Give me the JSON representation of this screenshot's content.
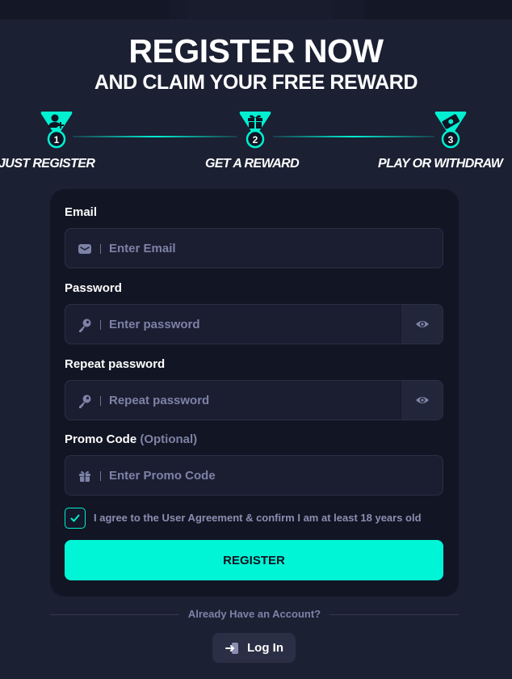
{
  "header": {
    "title": "REGISTER NOW",
    "subtitle": "AND CLAIM YOUR FREE REWARD"
  },
  "steps": [
    {
      "number": "1",
      "label": "JUST REGISTER",
      "icon": "user-add-icon"
    },
    {
      "number": "2",
      "label": "GET A REWARD",
      "icon": "gift-icon"
    },
    {
      "number": "3",
      "label": "PLAY OR WITHDRAW",
      "icon": "cash-icon"
    }
  ],
  "form": {
    "email": {
      "label": "Email",
      "placeholder": "Enter Email",
      "value": "",
      "icon": "mail-icon"
    },
    "password": {
      "label": "Password",
      "placeholder": "Enter password",
      "value": "",
      "icon": "key-icon"
    },
    "repeat_password": {
      "label": "Repeat password",
      "placeholder": "Repeat password",
      "value": "",
      "icon": "key-icon"
    },
    "promo": {
      "label": "Promo Code",
      "optional": "(Optional)",
      "placeholder": "Enter Promo Code",
      "value": "",
      "icon": "gift-icon"
    },
    "agree_text": "I agree to the User Agreement & confirm I am at least 18 years old",
    "agree_checked": true,
    "register_label": "REGISTER"
  },
  "footer": {
    "have_account": "Already Have an Account?",
    "login_label": "Log In"
  },
  "colors": {
    "background": "#1c2033",
    "card": "#121523",
    "accent": "#00f5d6",
    "muted_text": "#7d82a6"
  }
}
